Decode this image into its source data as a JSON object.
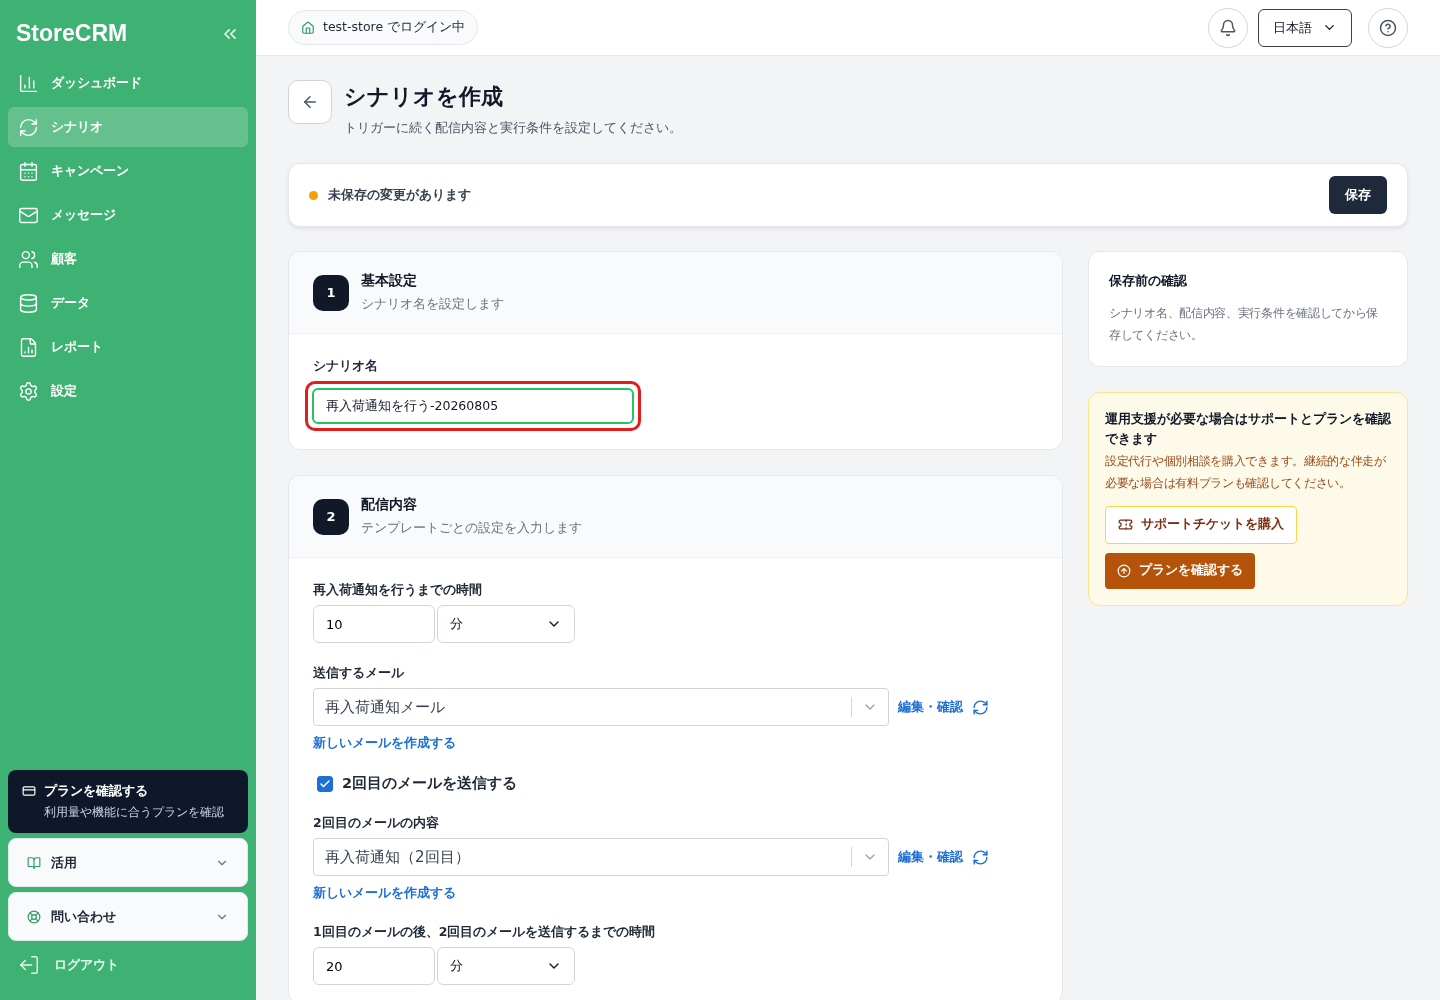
{
  "sidebar": {
    "logo": "StoreCRM",
    "items": [
      {
        "label": "ダッシュボード",
        "selected": false
      },
      {
        "label": "シナリオ",
        "selected": true
      },
      {
        "label": "キャンペーン",
        "selected": false
      },
      {
        "label": "メッセージ",
        "selected": false
      },
      {
        "label": "顧客",
        "selected": false
      },
      {
        "label": "データ",
        "selected": false
      },
      {
        "label": "レポート",
        "selected": false
      },
      {
        "label": "設定",
        "selected": false
      }
    ],
    "plan_card": {
      "title": "プランを確認する",
      "subtitle": "利用量や機能に合うプランを確認"
    },
    "sections": [
      {
        "label": "活用",
        "expanded": false
      },
      {
        "label": "問い合わせ",
        "expanded": false
      }
    ],
    "logout": "ログアウト"
  },
  "header": {
    "store_badge": "test-store でログイン中",
    "language": "日本語"
  },
  "page": {
    "title": "シナリオを作成",
    "subtitle": "トリガーに続く配信内容と実行条件を設定してください。"
  },
  "unsaved_bar": {
    "message": "未保存の変更があります",
    "save_button": "保存"
  },
  "steps": [
    {
      "number": "1",
      "title": "基本設定",
      "subtitle": "シナリオ名を設定します",
      "fields": [
        {
          "kind": "text",
          "label": "シナリオ名",
          "value": "再入荷通知を行う-20260805",
          "highlighted": true
        }
      ]
    },
    {
      "number": "2",
      "title": "配信内容",
      "subtitle": "テンプレートごとの設定を入力します",
      "fields": [
        {
          "kind": "duration",
          "label": "再入荷通知を行うまでの時間",
          "value": "10",
          "unit": "分"
        },
        {
          "kind": "mail",
          "label": "送信するメール",
          "value": "再入荷通知メール",
          "edit_link": "編集・確認",
          "create_link": "新しいメールを作成する"
        },
        {
          "kind": "checkbox",
          "label": "2回目のメールを送信する",
          "checked": true
        },
        {
          "kind": "mail",
          "label": "2回目のメールの内容",
          "value": "再入荷通知（2回目）",
          "edit_link": "編集・確認",
          "create_link": "新しいメールを作成する"
        },
        {
          "kind": "duration",
          "label": "1回目のメールの後、2回目のメールを送信するまでの時間",
          "value": "20",
          "unit": "分"
        }
      ]
    }
  ],
  "review_card": {
    "title": "保存前の確認",
    "body": "シナリオ名、配信内容、実行条件を確認してから保存してください。"
  },
  "support_card": {
    "title": "運用支援が必要な場合はサポートとプランを確認できます",
    "body": "設定代行や個別相談を購入できます。継続的な伴走が必要な場合は有料プランも確認してください。",
    "ticket_button": "サポートチケットを購入",
    "plan_button": "プランを確認する"
  }
}
